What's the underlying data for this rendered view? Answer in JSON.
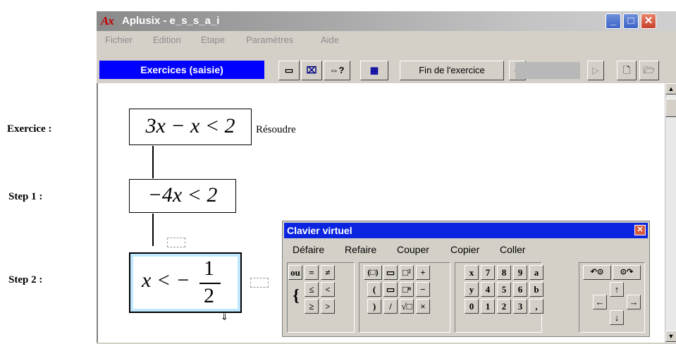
{
  "side_labels": {
    "exercise": "Exercice :",
    "step1": "Step 1 :",
    "step2": "Step 2 :"
  },
  "window": {
    "app_icon": "Ax",
    "title": "Aplusix - e_s_s_a_i",
    "title_buttons": {
      "minimize": "_",
      "maximize": "□",
      "close": "✕"
    }
  },
  "menu": [
    "Fichier",
    "Edition",
    "Etape",
    "Paramètres",
    "Aide"
  ],
  "toolbar": {
    "mode_label": "Exercices (saisie)",
    "btn_rect": "▭",
    "btn_cancel": "⌧",
    "btn_equiv": "⇔?",
    "btn_keyboard": "▦",
    "end_exercise": "Fin de l'exercice",
    "nav_prev": "◁",
    "nav_next": "▷",
    "btn_new": "🗋",
    "btn_open": "🗁"
  },
  "exercise": {
    "expression": "3x − x < 2",
    "instruction": "Résoudre",
    "step1": "−4x < 2",
    "step2_lhs": "x < −",
    "step2_num": "1",
    "step2_den": "2",
    "cursor_mark": "⇓"
  },
  "keyboard": {
    "title": "Clavier virtuel",
    "close": "✕",
    "menu": [
      "Défaire",
      "Refaire",
      "Couper",
      "Copier",
      "Coller"
    ],
    "keys_logic": [
      "ou",
      "=",
      "≠",
      "≤",
      "<",
      "≥",
      ">"
    ],
    "brace": "{",
    "keys_struct": [
      "(□)",
      "▭",
      "□²",
      "+",
      "(",
      "▭",
      "□ⁿ",
      "−",
      ")",
      "/",
      "√□",
      "×"
    ],
    "keys_digits": [
      "x",
      "7",
      "8",
      "9",
      "a",
      "y",
      "4",
      "5",
      "6",
      "b",
      "0",
      "1",
      "2",
      "3",
      ","
    ],
    "keys_nav": [
      "↶⊙",
      "⊙↷",
      "↑",
      "←",
      "→",
      "↓"
    ]
  },
  "scroll": {
    "up": "▲",
    "down": "▼"
  }
}
